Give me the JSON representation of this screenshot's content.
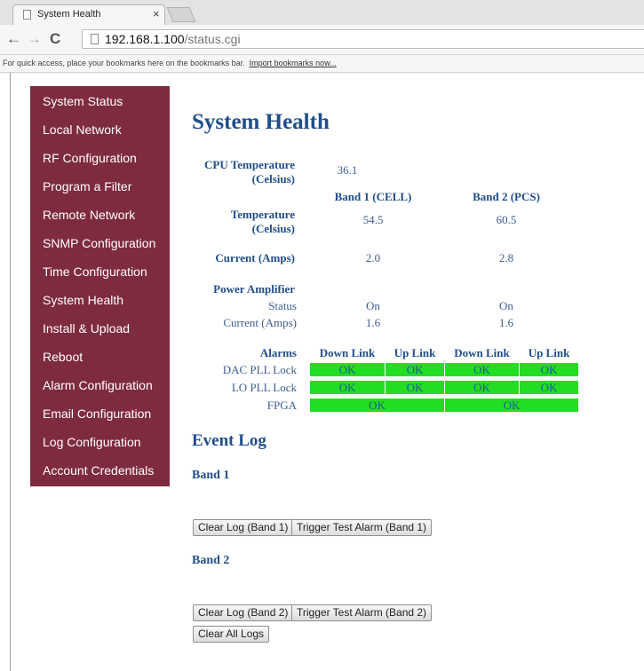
{
  "browser": {
    "tab_title": "System Health",
    "tab_close": "×",
    "url_host": "192.168.1.100",
    "url_path": "/status.cgi",
    "bookmarks_message": "For quick access, place your bookmarks here on the bookmarks bar.",
    "bookmarks_link": "Import bookmarks now..."
  },
  "sidebar": {
    "items": [
      {
        "label": "System Status"
      },
      {
        "label": "Local Network"
      },
      {
        "label": "RF Configuration"
      },
      {
        "label": "Program a Filter"
      },
      {
        "label": "Remote Network"
      },
      {
        "label": "SNMP Configuration"
      },
      {
        "label": "Time Configuration"
      },
      {
        "label": "System Health"
      },
      {
        "label": "Install & Upload"
      },
      {
        "label": "Reboot"
      },
      {
        "label": "Alarm Configuration"
      },
      {
        "label": "Email Configuration"
      },
      {
        "label": "Log Configuration"
      },
      {
        "label": "Account Credentials"
      }
    ]
  },
  "health": {
    "title": "System Health",
    "cpu_temp_label_1": "CPU Temperature",
    "cpu_temp_label_2": "(Celsius)",
    "cpu_temp_value": "36.1",
    "band1_header": "Band 1 (CELL)",
    "band2_header": "Band 2 (PCS)",
    "temp_label_1": "Temperature",
    "temp_label_2": "(Celsius)",
    "temp_band1": "54.5",
    "temp_band2": "60.5",
    "current_label": "Current (Amps)",
    "current_band1": "2.0",
    "current_band2": "2.8",
    "pa_label": "Power Amplifier",
    "pa_status_label": "Status",
    "pa_status_band1": "On",
    "pa_status_band2": "On",
    "pa_current_label": "Current (Amps)",
    "pa_current_band1": "1.6",
    "pa_current_band2": "1.6"
  },
  "alarms": {
    "header": "Alarms",
    "col_down1": "Down Link",
    "col_up1": "Up Link",
    "col_down2": "Down Link",
    "col_up2": "Up Link",
    "rows": [
      {
        "label": "DAC PLL Lock",
        "values": [
          "OK",
          "OK",
          "OK",
          "OK"
        ]
      },
      {
        "label": "LO PLL Lock",
        "values": [
          "OK",
          "OK",
          "OK",
          "OK"
        ]
      },
      {
        "label": "FPGA",
        "values": [
          "OK",
          "OK"
        ]
      }
    ],
    "ok_color": "#22dd22"
  },
  "event_log": {
    "title": "Event Log",
    "band1_title": "Band 1",
    "band2_title": "Band 2",
    "clear_band1": "Clear Log (Band 1)",
    "test_band1": "Trigger Test Alarm (Band 1)",
    "clear_band2": "Clear Log (Band 2)",
    "test_band2": "Trigger Test Alarm (Band 2)",
    "clear_all": "Clear All Logs"
  }
}
